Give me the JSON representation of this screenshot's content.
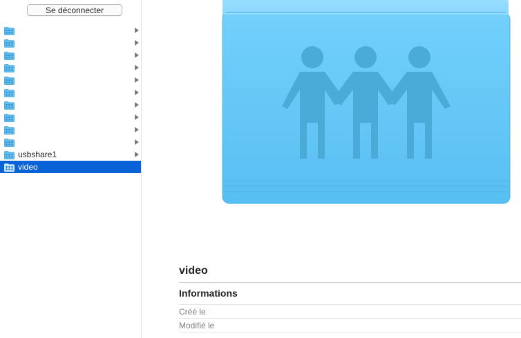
{
  "sidebar": {
    "disconnect_label": "Se déconnecter",
    "shares": [
      {
        "label": "",
        "selected": false,
        "has_arrow": true
      },
      {
        "label": "",
        "selected": false,
        "has_arrow": true
      },
      {
        "label": "",
        "selected": false,
        "has_arrow": true
      },
      {
        "label": "",
        "selected": false,
        "has_arrow": true
      },
      {
        "label": "",
        "selected": false,
        "has_arrow": true
      },
      {
        "label": "",
        "selected": false,
        "has_arrow": true
      },
      {
        "label": "",
        "selected": false,
        "has_arrow": true
      },
      {
        "label": "",
        "selected": false,
        "has_arrow": true
      },
      {
        "label": "",
        "selected": false,
        "has_arrow": true
      },
      {
        "label": "",
        "selected": false,
        "has_arrow": true
      },
      {
        "label": "usbshare1",
        "selected": false,
        "has_arrow": true
      },
      {
        "label": "video",
        "selected": true,
        "has_arrow": false
      }
    ]
  },
  "preview": {
    "icon": "shared-folder-icon",
    "item_name": "video",
    "section_title": "Informations",
    "properties": [
      {
        "label": "Créé le",
        "value": ""
      },
      {
        "label": "Modifié le",
        "value": ""
      }
    ]
  },
  "colors": {
    "selection": "#0a63d6",
    "folder_blue": "#5ec3f4"
  }
}
